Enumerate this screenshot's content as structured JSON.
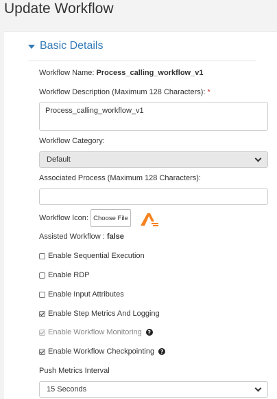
{
  "page": {
    "title": "Update Workflow"
  },
  "section": {
    "title": "Basic Details"
  },
  "workflow_name": {
    "label": "Workflow Name:",
    "value": "Process_calling_workflow_v1"
  },
  "description": {
    "label": "Workflow Description (Maximum 128 Characters):",
    "required": "*",
    "value": "Process_calling_workflow_v1"
  },
  "category": {
    "label": "Workflow Category:",
    "selected": "Default"
  },
  "associated_process": {
    "label": "Associated Process (Maximum 128 Characters):",
    "value": ""
  },
  "icon": {
    "label": "Workflow Icon:",
    "button": "Choose File",
    "logo_icon": "automation-anywhere-logo-icon"
  },
  "assisted": {
    "label": "Assisted Workflow :",
    "value": "false"
  },
  "options": [
    {
      "label": "Enable Sequential Execution",
      "checked": false,
      "disabled": false,
      "help": false
    },
    {
      "label": "Enable RDP",
      "checked": false,
      "disabled": false,
      "help": false
    },
    {
      "label": "Enable Input Attributes",
      "checked": false,
      "disabled": false,
      "help": false
    },
    {
      "label": "Enable Step Metrics And Logging",
      "checked": true,
      "disabled": false,
      "help": false
    },
    {
      "label": "Enable Workflow Monitoring",
      "checked": true,
      "disabled": true,
      "help": true
    },
    {
      "label": "Enable Workflow Checkpointing",
      "checked": true,
      "disabled": false,
      "help": true
    }
  ],
  "help_glyph": "?",
  "push_metrics": {
    "label": "Push Metrics Interval",
    "selected": "15 Seconds"
  },
  "colors": {
    "accent": "#337ab7",
    "required": "#c9302c",
    "logo": "#f5821f"
  }
}
